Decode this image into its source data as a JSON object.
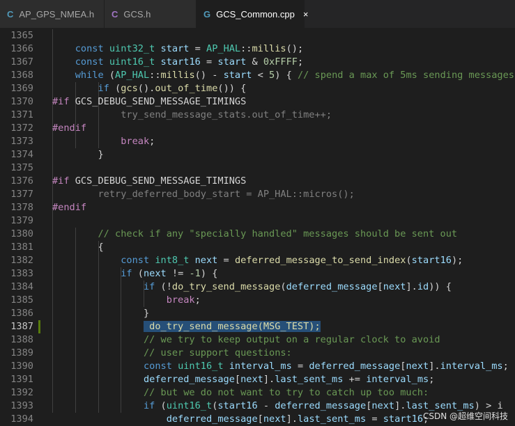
{
  "tabs": [
    {
      "icon": "C",
      "icon_color": "#519aba",
      "label": "AP_GPS_NMEA.h",
      "active": false
    },
    {
      "icon": "C",
      "icon_color": "#a074c4",
      "label": "GCS.h",
      "active": false
    },
    {
      "icon": "G",
      "icon_color": "#519aba",
      "label": "GCS_Common.cpp",
      "active": true,
      "close": "×"
    }
  ],
  "colors": {
    "keyword": "#569cd6",
    "type": "#4ec9b0",
    "function": "#dcdcaa",
    "comment": "#6a9955",
    "preprocessor": "#c586c0",
    "number": "#b5cea8",
    "variable": "#9cdcfe",
    "inactive": "#808080",
    "plain": "#d4d4d4"
  },
  "editor": {
    "current_line": "1387",
    "modified_line": "1387",
    "lines": [
      {
        "num": "1365",
        "tokens": []
      },
      {
        "num": "1366",
        "tokens": [
          {
            "t": "    "
          },
          {
            "t": "const",
            "c": "keyword"
          },
          {
            "t": " "
          },
          {
            "t": "uint32_t",
            "c": "type"
          },
          {
            "t": " "
          },
          {
            "t": "start",
            "c": "variable"
          },
          {
            "t": " = "
          },
          {
            "t": "AP_HAL",
            "c": "type"
          },
          {
            "t": "::"
          },
          {
            "t": "millis",
            "c": "function"
          },
          {
            "t": "();"
          }
        ]
      },
      {
        "num": "1367",
        "tokens": [
          {
            "t": "    "
          },
          {
            "t": "const",
            "c": "keyword"
          },
          {
            "t": " "
          },
          {
            "t": "uint16_t",
            "c": "type"
          },
          {
            "t": " "
          },
          {
            "t": "start16",
            "c": "variable"
          },
          {
            "t": " = "
          },
          {
            "t": "start",
            "c": "variable"
          },
          {
            "t": " & "
          },
          {
            "t": "0xFFFF",
            "c": "number"
          },
          {
            "t": ";"
          }
        ]
      },
      {
        "num": "1368",
        "tokens": [
          {
            "t": "    "
          },
          {
            "t": "while",
            "c": "keyword"
          },
          {
            "t": " ("
          },
          {
            "t": "AP_HAL",
            "c": "type"
          },
          {
            "t": "::"
          },
          {
            "t": "millis",
            "c": "function"
          },
          {
            "t": "() - "
          },
          {
            "t": "start",
            "c": "variable"
          },
          {
            "t": " < "
          },
          {
            "t": "5",
            "c": "number"
          },
          {
            "t": ") { "
          },
          {
            "t": "// spend a max of 5ms sending messages",
            "c": "comment"
          }
        ]
      },
      {
        "num": "1369",
        "tokens": [
          {
            "t": "        "
          },
          {
            "t": "if",
            "c": "keyword"
          },
          {
            "t": " ("
          },
          {
            "t": "gcs",
            "c": "function"
          },
          {
            "t": "()."
          },
          {
            "t": "out_of_time",
            "c": "function"
          },
          {
            "t": "()) {"
          }
        ]
      },
      {
        "num": "1370",
        "tokens": [
          {
            "t": "#if",
            "c": "preprocessor"
          },
          {
            "t": " GCS_DEBUG_SEND_MESSAGE_TIMINGS"
          }
        ]
      },
      {
        "num": "1371",
        "tokens": [
          {
            "t": "            try_send_message_stats.out_of_time++;",
            "c": "inactive"
          }
        ]
      },
      {
        "num": "1372",
        "tokens": [
          {
            "t": "#endif",
            "c": "preprocessor"
          }
        ]
      },
      {
        "num": "1373",
        "tokens": [
          {
            "t": "            "
          },
          {
            "t": "break",
            "c": "preprocessor"
          },
          {
            "t": ";"
          }
        ]
      },
      {
        "num": "1374",
        "tokens": [
          {
            "t": "        }"
          }
        ]
      },
      {
        "num": "1375",
        "tokens": []
      },
      {
        "num": "1376",
        "tokens": [
          {
            "t": "#if",
            "c": "preprocessor"
          },
          {
            "t": " GCS_DEBUG_SEND_MESSAGE_TIMINGS"
          }
        ]
      },
      {
        "num": "1377",
        "tokens": [
          {
            "t": "        retry_deferred_body_start = AP_HAL::micros();",
            "c": "inactive"
          }
        ]
      },
      {
        "num": "1378",
        "tokens": [
          {
            "t": "#endif",
            "c": "preprocessor"
          }
        ]
      },
      {
        "num": "1379",
        "tokens": []
      },
      {
        "num": "1380",
        "tokens": [
          {
            "t": "        "
          },
          {
            "t": "// check if any \"specially handled\" messages should be sent out",
            "c": "comment"
          }
        ]
      },
      {
        "num": "1381",
        "tokens": [
          {
            "t": "        {"
          }
        ]
      },
      {
        "num": "1382",
        "tokens": [
          {
            "t": "            "
          },
          {
            "t": "const",
            "c": "keyword"
          },
          {
            "t": " "
          },
          {
            "t": "int8_t",
            "c": "type"
          },
          {
            "t": " "
          },
          {
            "t": "next",
            "c": "variable"
          },
          {
            "t": " = "
          },
          {
            "t": "deferred_message_to_send_index",
            "c": "function"
          },
          {
            "t": "("
          },
          {
            "t": "start16",
            "c": "variable"
          },
          {
            "t": ");"
          }
        ]
      },
      {
        "num": "1383",
        "tokens": [
          {
            "t": "            "
          },
          {
            "t": "if",
            "c": "keyword"
          },
          {
            "t": " ("
          },
          {
            "t": "next",
            "c": "variable"
          },
          {
            "t": " != "
          },
          {
            "t": "-1",
            "c": "number"
          },
          {
            "t": ") {"
          }
        ]
      },
      {
        "num": "1384",
        "tokens": [
          {
            "t": "                "
          },
          {
            "t": "if",
            "c": "keyword"
          },
          {
            "t": " (!"
          },
          {
            "t": "do_try_send_message",
            "c": "function"
          },
          {
            "t": "("
          },
          {
            "t": "deferred_message",
            "c": "variable"
          },
          {
            "t": "["
          },
          {
            "t": "next",
            "c": "variable"
          },
          {
            "t": "]."
          },
          {
            "t": "id",
            "c": "variable"
          },
          {
            "t": ")) {"
          }
        ]
      },
      {
        "num": "1385",
        "tokens": [
          {
            "t": "                    "
          },
          {
            "t": "break",
            "c": "preprocessor"
          },
          {
            "t": ";"
          }
        ]
      },
      {
        "num": "1386",
        "tokens": [
          {
            "t": "                }"
          }
        ]
      },
      {
        "num": "1387",
        "tokens": [
          {
            "t": "                "
          },
          {
            "t": " do_try_send_message(MSG_TEST);",
            "c": "function",
            "sel": true
          }
        ]
      },
      {
        "num": "1388",
        "tokens": [
          {
            "t": "                "
          },
          {
            "t": "// we try to keep output on a regular clock to avoid",
            "c": "comment"
          }
        ]
      },
      {
        "num": "1389",
        "tokens": [
          {
            "t": "                "
          },
          {
            "t": "// user support questions:",
            "c": "comment"
          }
        ]
      },
      {
        "num": "1390",
        "tokens": [
          {
            "t": "                "
          },
          {
            "t": "const",
            "c": "keyword"
          },
          {
            "t": " "
          },
          {
            "t": "uint16_t",
            "c": "type"
          },
          {
            "t": " "
          },
          {
            "t": "interval_ms",
            "c": "variable"
          },
          {
            "t": " = "
          },
          {
            "t": "deferred_message",
            "c": "variable"
          },
          {
            "t": "["
          },
          {
            "t": "next",
            "c": "variable"
          },
          {
            "t": "]."
          },
          {
            "t": "interval_ms",
            "c": "variable"
          },
          {
            "t": ";"
          }
        ]
      },
      {
        "num": "1391",
        "tokens": [
          {
            "t": "                "
          },
          {
            "t": "deferred_message",
            "c": "variable"
          },
          {
            "t": "["
          },
          {
            "t": "next",
            "c": "variable"
          },
          {
            "t": "]."
          },
          {
            "t": "last_sent_ms",
            "c": "variable"
          },
          {
            "t": " += "
          },
          {
            "t": "interval_ms",
            "c": "variable"
          },
          {
            "t": ";"
          }
        ]
      },
      {
        "num": "1392",
        "tokens": [
          {
            "t": "                "
          },
          {
            "t": "// but we do not want to try to catch up too much:",
            "c": "comment"
          }
        ]
      },
      {
        "num": "1393",
        "tokens": [
          {
            "t": "                "
          },
          {
            "t": "if",
            "c": "keyword"
          },
          {
            "t": " ("
          },
          {
            "t": "uint16_t",
            "c": "type"
          },
          {
            "t": "("
          },
          {
            "t": "start16",
            "c": "variable"
          },
          {
            "t": " - "
          },
          {
            "t": "deferred_message",
            "c": "variable"
          },
          {
            "t": "["
          },
          {
            "t": "next",
            "c": "variable"
          },
          {
            "t": "]."
          },
          {
            "t": "last_sent_ms",
            "c": "variable"
          },
          {
            "t": ") > i"
          }
        ]
      },
      {
        "num": "1394",
        "tokens": [
          {
            "t": "                    "
          },
          {
            "t": "deferred_message",
            "c": "variable"
          },
          {
            "t": "["
          },
          {
            "t": "next",
            "c": "variable"
          },
          {
            "t": "]."
          },
          {
            "t": "last_sent_ms",
            "c": "variable"
          },
          {
            "t": " = "
          },
          {
            "t": "start16",
            "c": "variable"
          },
          {
            "t": ";"
          }
        ]
      }
    ]
  },
  "watermark": "CSDN @超维空间科技"
}
